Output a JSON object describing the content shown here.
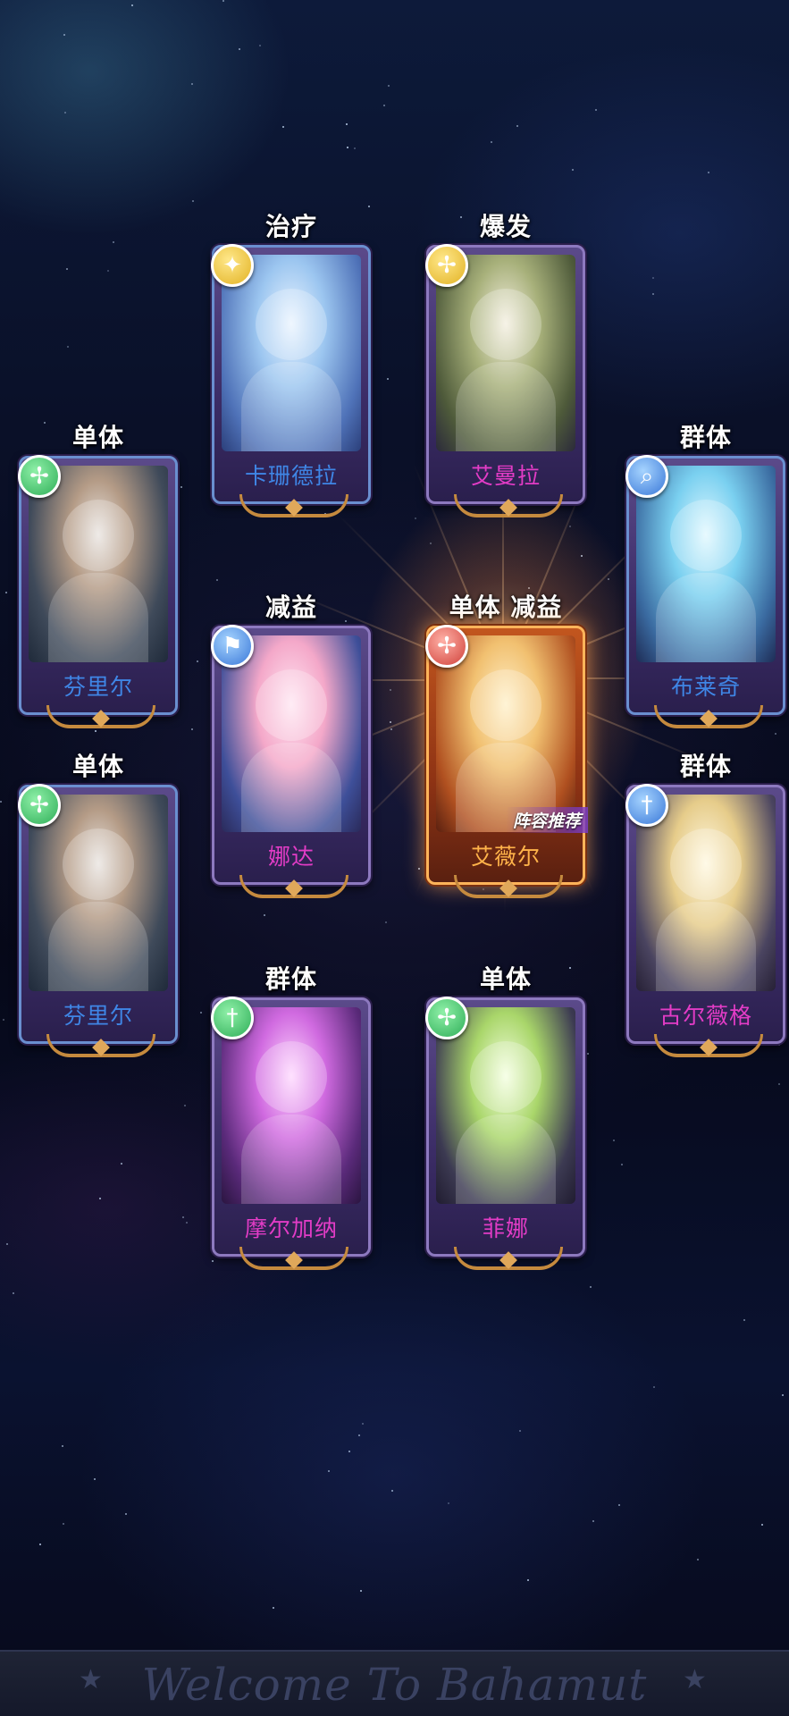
{
  "colors": {
    "name_blue": "#3f86e6",
    "name_pink": "#e23cc6",
    "name_gold": "#ffb34a",
    "card_frame": "#8d79bf",
    "card_highlight": "#ffb45a",
    "background": "#05060f"
  },
  "characters": [
    {
      "id": "karandra",
      "role": "治疗",
      "name": "卡珊德拉",
      "badge_icon": "angel-wing-icon",
      "badge_color": "yellow",
      "name_color": "blue"
    },
    {
      "id": "emanla",
      "role": "爆发",
      "name": "艾曼拉",
      "badge_icon": "shuriken-icon",
      "badge_color": "yellow",
      "name_color": "pink"
    },
    {
      "id": "fenrir1",
      "role": "单体",
      "name": "芬里尔",
      "badge_icon": "shuriken-icon",
      "badge_color": "green",
      "name_color": "blue"
    },
    {
      "id": "brachi",
      "role": "群体",
      "name": "布莱奇",
      "badge_icon": "magnifier-icon",
      "badge_color": "blue",
      "name_color": "blue"
    },
    {
      "id": "nada",
      "role": "减益",
      "name": "娜达",
      "badge_icon": "banner-icon",
      "badge_color": "blue",
      "name_color": "pink"
    },
    {
      "id": "avril",
      "role": "单体 减益",
      "name": "艾薇尔",
      "badge_icon": "shuriken-icon",
      "badge_color": "red",
      "name_color": "gold",
      "tag": "阵容推荐"
    },
    {
      "id": "fenrir2",
      "role": "单体",
      "name": "芬里尔",
      "badge_icon": "shuriken-icon",
      "badge_color": "green",
      "name_color": "blue"
    },
    {
      "id": "gulweig",
      "role": "群体",
      "name": "古尔薇格",
      "badge_icon": "sword-icon",
      "badge_color": "blue",
      "name_color": "pink"
    },
    {
      "id": "morgana",
      "role": "群体",
      "name": "摩尔加纳",
      "badge_icon": "sword-icon",
      "badge_color": "green",
      "name_color": "pink"
    },
    {
      "id": "fina",
      "role": "单体",
      "name": "菲娜",
      "badge_icon": "shuriken-icon",
      "badge_color": "green",
      "name_color": "pink"
    }
  ],
  "footer": {
    "welcome_text": "Welcome To Bahamut",
    "star_icon": "star-icon"
  }
}
